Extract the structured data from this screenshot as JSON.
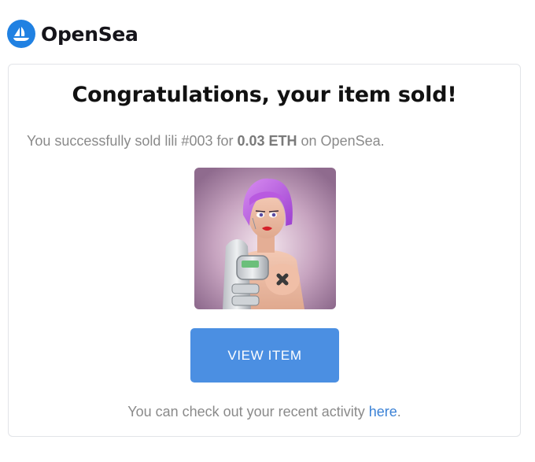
{
  "brand": {
    "name": "OpenSea",
    "logo_icon": "opensea-sailboat-icon",
    "accent_color": "#2081e2"
  },
  "email": {
    "title": "Congratulations, your item sold!",
    "message": {
      "prefix": "You successfully sold lili #003 for ",
      "amount": "0.03 ETH",
      "suffix": " on OpenSea."
    },
    "item_image": {
      "description_icon": "nft-artwork-image"
    },
    "view_button_label": "VIEW ITEM",
    "button_color": "#4b8fe2",
    "footer": {
      "prefix": "You can check out your recent activity ",
      "link_text": "here",
      "suffix": "."
    }
  }
}
